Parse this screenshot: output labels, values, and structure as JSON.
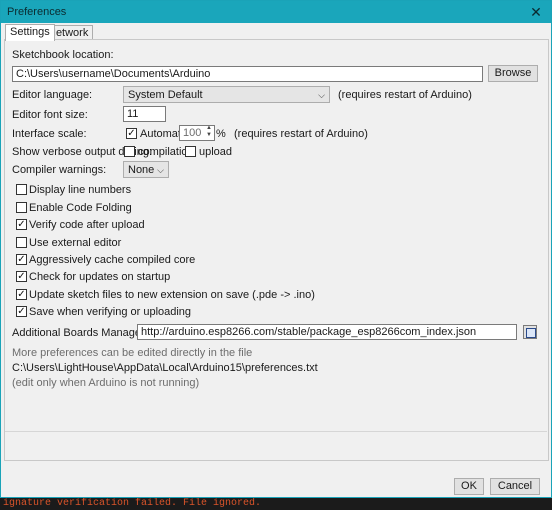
{
  "window": {
    "title": "Preferences",
    "close_glyph": "✕"
  },
  "tabs": [
    {
      "label": "Settings"
    },
    {
      "label": "Network"
    }
  ],
  "sketchbook": {
    "label": "Sketchbook location:",
    "path": "C:\\Users\\username\\Documents\\Arduino",
    "browse_label": "Browse"
  },
  "language": {
    "label": "Editor language:",
    "value": "System Default",
    "note": "(requires restart of Arduino)"
  },
  "font_size": {
    "label": "Editor font size:",
    "value": "11"
  },
  "scale": {
    "label": "Interface scale:",
    "automatic_label": "Automatic",
    "automatic_checked": true,
    "value": "100",
    "unit": "%",
    "note": "(requires restart of Arduino)"
  },
  "verbose": {
    "label": "Show verbose output during:",
    "compilation_label": "compilation",
    "upload_label": "upload"
  },
  "warnings": {
    "label": "Compiler warnings:",
    "value": "None"
  },
  "checkboxes": [
    {
      "label": "Display line numbers",
      "checked": false
    },
    {
      "label": "Enable Code Folding",
      "checked": false
    },
    {
      "label": "Verify code after upload",
      "checked": true
    },
    {
      "label": "Use external editor",
      "checked": false
    },
    {
      "label": "Aggressively cache compiled core",
      "checked": true
    },
    {
      "label": "Check for updates on startup",
      "checked": true
    },
    {
      "label": "Update sketch files to new extension on save (.pde -> .ino)",
      "checked": true
    },
    {
      "label": "Save when verifying or uploading",
      "checked": true
    }
  ],
  "boards": {
    "label": "Additional Boards Manager URLs:",
    "url": "http://arduino.esp8266.com/stable/package_esp8266com_index.json"
  },
  "info": {
    "more": "More preferences can be edited directly in the file",
    "path": "C:\\Users\\LightHouse\\AppData\\Local\\Arduino15\\preferences.txt",
    "edit_note": "(edit only when Arduino is not running)"
  },
  "buttons": {
    "ok": "OK",
    "cancel": "Cancel"
  },
  "background": {
    "error_text": "ignature verification failed. File ignored."
  },
  "colors": {
    "titlebar": "#1aa6bb",
    "error_text": "#d9542a"
  }
}
